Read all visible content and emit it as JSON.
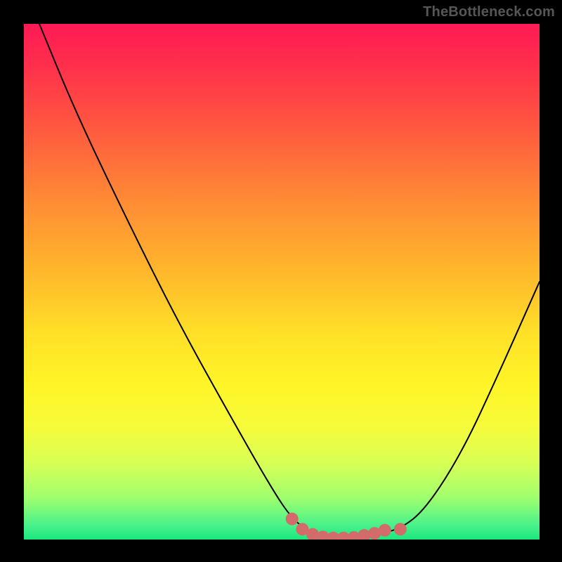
{
  "brand": {
    "label": "TheBottleneck.com"
  },
  "chart_data": {
    "type": "line",
    "title": "",
    "xlabel": "",
    "ylabel": "",
    "xlim": [
      0,
      100
    ],
    "ylim": [
      0,
      100
    ],
    "grid": false,
    "legend": false,
    "series": [
      {
        "name": "bottleneck-curve",
        "x": [
          3,
          10,
          20,
          30,
          40,
          48,
          52,
          56,
          60,
          64,
          68,
          73,
          78,
          85,
          92,
          100
        ],
        "y": [
          100,
          83,
          62,
          42,
          24,
          10,
          4,
          1,
          0,
          0,
          1,
          2,
          6,
          17,
          32,
          50
        ]
      }
    ],
    "highlight_beads": {
      "name": "optimal-range-marker",
      "color": "#d36b6b",
      "points": [
        {
          "x": 52,
          "y": 4
        },
        {
          "x": 54,
          "y": 2
        },
        {
          "x": 56,
          "y": 1
        },
        {
          "x": 58,
          "y": 0.5
        },
        {
          "x": 60,
          "y": 0.3
        },
        {
          "x": 62,
          "y": 0.3
        },
        {
          "x": 64,
          "y": 0.4
        },
        {
          "x": 66,
          "y": 0.8
        },
        {
          "x": 68,
          "y": 1.2
        },
        {
          "x": 70,
          "y": 1.8
        },
        {
          "x": 73,
          "y": 2
        }
      ]
    },
    "background_gradient_stops": [
      {
        "pos": 0,
        "color": "#ff1a55"
      },
      {
        "pos": 34,
        "color": "#ff8a35"
      },
      {
        "pos": 60,
        "color": "#ffe028"
      },
      {
        "pos": 85,
        "color": "#d9ff55"
      },
      {
        "pos": 100,
        "color": "#1ce77f"
      }
    ]
  }
}
